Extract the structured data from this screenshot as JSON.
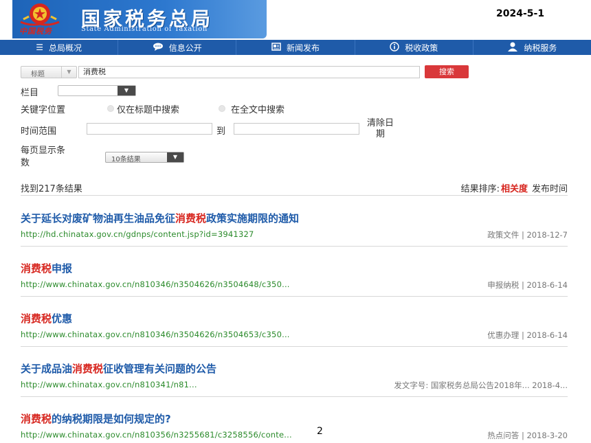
{
  "header": {
    "title": "国家税务总局",
    "subtitle": "State Administration of Taxation",
    "brand_mark": "中国税务",
    "date": "2024-5-1"
  },
  "nav": [
    {
      "label": "总局概况",
      "icon": "menu-icon"
    },
    {
      "label": "信息公开",
      "icon": "chat-icon"
    },
    {
      "label": "新闻发布",
      "icon": "document-icon"
    },
    {
      "label": "税收政策",
      "icon": "info-icon"
    },
    {
      "label": "纳税服务",
      "icon": "person-icon"
    }
  ],
  "search": {
    "scope_value": "标题",
    "keyword": "消费税",
    "button": "搜索"
  },
  "filters": {
    "column_label": "栏目",
    "keyword_position_label": "关键字位置",
    "option_title": "仅在标题中搜索",
    "option_fulltext": "在全文中搜索",
    "time_range_label": "时间范围",
    "to_label": "到",
    "clear_date_line1": "清除日",
    "clear_date_line2": "期",
    "per_page_label_line1": "每页显示条",
    "per_page_label_line2": "数",
    "per_page_value": "10条结果"
  },
  "summary": {
    "found": "找到217条结果",
    "sort_label": "结果排序:",
    "sort_relevance": "相关度",
    "sort_date": "发布时间"
  },
  "results": [
    {
      "title_pre": "关于延长对废矿物油再生油品免征",
      "title_hl": "消费税",
      "title_post": "政策实施期限的通知",
      "url": "http://hd.chinatax.gov.cn/gdnps/content.jsp?id=3941327",
      "meta": "政策文件 | 2018-12-7"
    },
    {
      "title_pre": "",
      "title_hl": "消费税",
      "title_post": "申报",
      "url": "http://www.chinatax.gov.cn/n810346/n3504626/n3504648/c350...",
      "meta": "申报纳税 | 2018-6-14"
    },
    {
      "title_pre": "",
      "title_hl": "消费税",
      "title_post": "优惠",
      "url": "http://www.chinatax.gov.cn/n810346/n3504626/n3504653/c350...",
      "meta": "优惠办理 | 2018-6-14"
    },
    {
      "title_pre": "关于成品油",
      "title_hl": "消费税",
      "title_post": "征收管理有关问题的公告",
      "url": "http://www.chinatax.gov.cn/n810341/n81...",
      "meta": "发文字号: 国家税务总局公告2018年...  2018-4..."
    },
    {
      "title_pre": "",
      "title_hl": "消费税",
      "title_post": "的纳税期限是如何规定的?",
      "url": "http://www.chinatax.gov.cn/n810356/n3255681/c3258556/conte...",
      "meta": "热点问答 | 2018-3-20"
    }
  ],
  "page_number": "2"
}
